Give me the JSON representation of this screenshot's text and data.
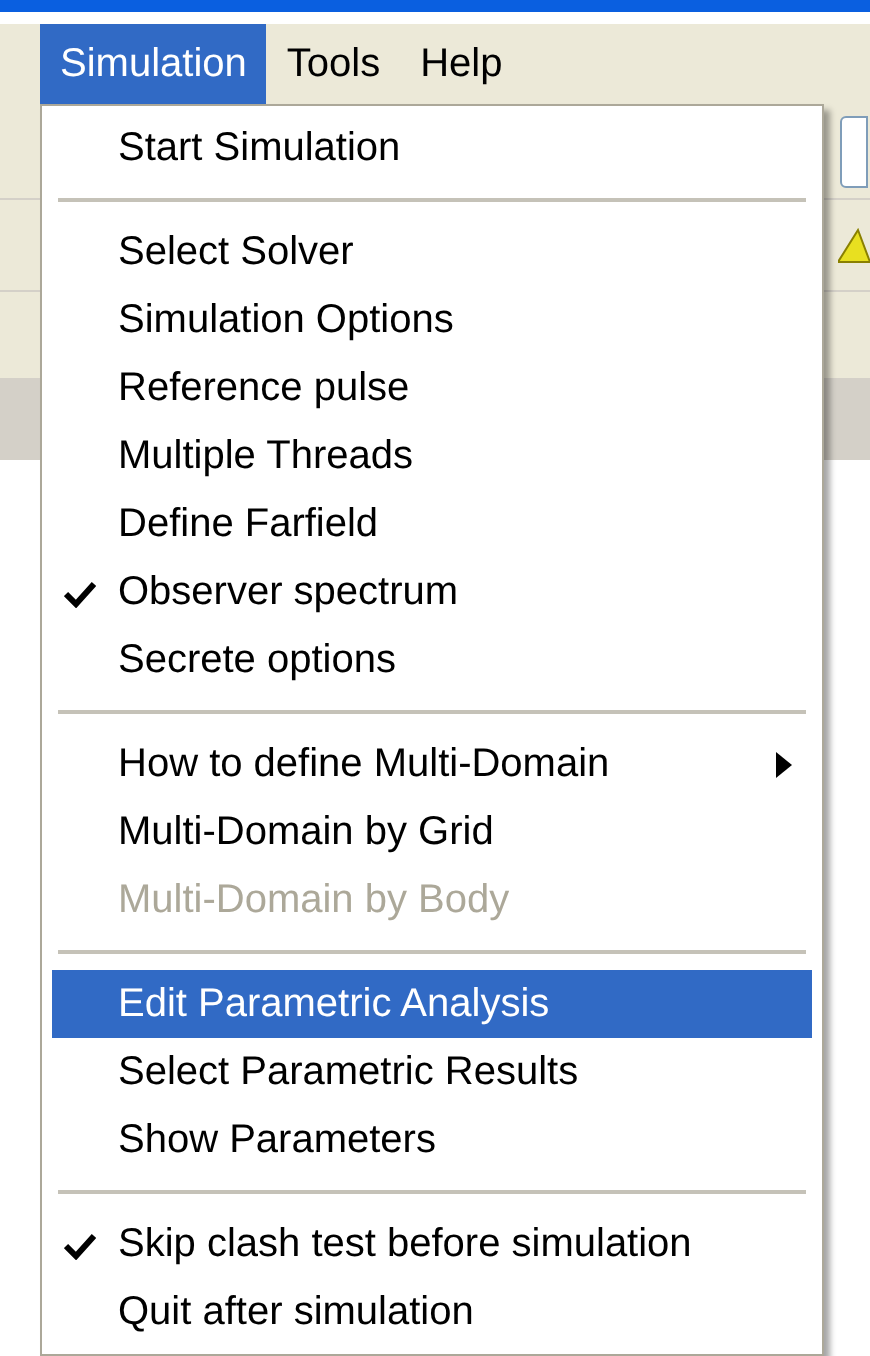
{
  "menu_bar": [
    {
      "label": "Simulation",
      "selected": true
    },
    {
      "label": "Tools",
      "selected": false
    },
    {
      "label": "Help",
      "selected": false
    }
  ],
  "menu": {
    "groups": [
      [
        {
          "label": "Start Simulation",
          "checked": false,
          "disabled": false,
          "selected": false,
          "submenu": false
        }
      ],
      [
        {
          "label": "Select Solver",
          "checked": false,
          "disabled": false,
          "selected": false,
          "submenu": false
        },
        {
          "label": "Simulation Options",
          "checked": false,
          "disabled": false,
          "selected": false,
          "submenu": false
        },
        {
          "label": "Reference pulse",
          "checked": false,
          "disabled": false,
          "selected": false,
          "submenu": false
        },
        {
          "label": "Multiple Threads",
          "checked": false,
          "disabled": false,
          "selected": false,
          "submenu": false
        },
        {
          "label": "Define Farfield",
          "checked": false,
          "disabled": false,
          "selected": false,
          "submenu": false
        },
        {
          "label": "Observer spectrum",
          "checked": true,
          "disabled": false,
          "selected": false,
          "submenu": false
        },
        {
          "label": "Secrete options",
          "checked": false,
          "disabled": false,
          "selected": false,
          "submenu": false
        }
      ],
      [
        {
          "label": "How to define Multi-Domain",
          "checked": false,
          "disabled": false,
          "selected": false,
          "submenu": true
        },
        {
          "label": "Multi-Domain by Grid",
          "checked": false,
          "disabled": false,
          "selected": false,
          "submenu": false
        },
        {
          "label": "Multi-Domain by Body",
          "checked": false,
          "disabled": true,
          "selected": false,
          "submenu": false
        }
      ],
      [
        {
          "label": "Edit Parametric Analysis",
          "checked": false,
          "disabled": false,
          "selected": true,
          "submenu": false
        },
        {
          "label": "Select Parametric Results",
          "checked": false,
          "disabled": false,
          "selected": false,
          "submenu": false
        },
        {
          "label": "Show Parameters",
          "checked": false,
          "disabled": false,
          "selected": false,
          "submenu": false
        }
      ],
      [
        {
          "label": "Skip clash test before simulation",
          "checked": true,
          "disabled": false,
          "selected": false,
          "submenu": false
        },
        {
          "label": "Quit after simulation",
          "checked": false,
          "disabled": false,
          "selected": false,
          "submenu": false
        }
      ]
    ]
  }
}
